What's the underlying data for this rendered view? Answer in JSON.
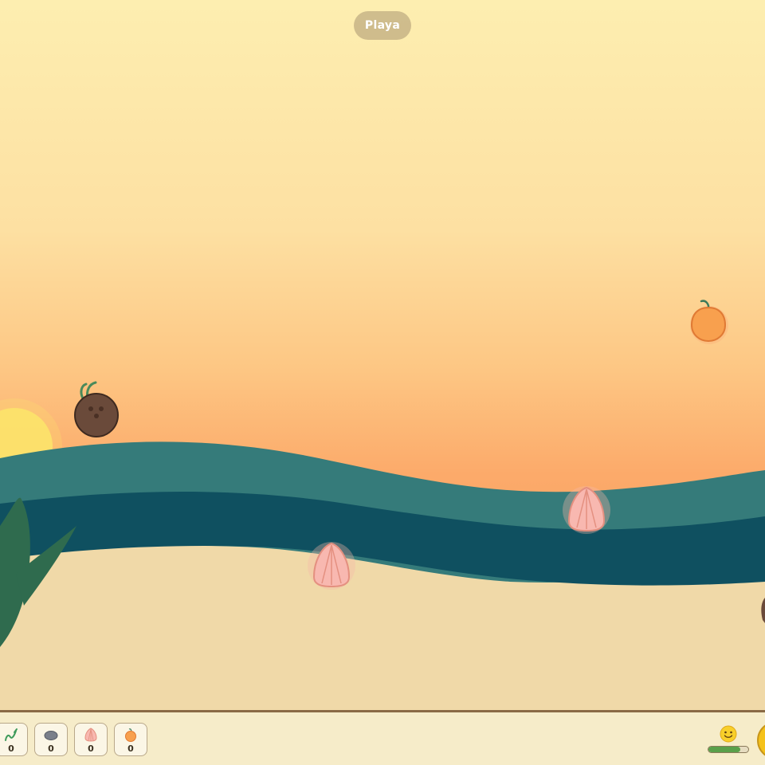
{
  "scene": {
    "location_label": "Playa"
  },
  "world_items": [
    {
      "kind": "coconut",
      "icon": "coconut-icon"
    },
    {
      "kind": "orange-fruit",
      "icon": "orange-fruit-icon"
    },
    {
      "kind": "seashell",
      "icon": "seashell-icon"
    },
    {
      "kind": "seashell",
      "icon": "seashell-icon"
    }
  ],
  "inventory": [
    {
      "icon": "seaweed-icon",
      "count": "0"
    },
    {
      "icon": "stone-icon",
      "count": "0"
    },
    {
      "icon": "seashell-icon",
      "count": "0"
    },
    {
      "icon": "orange-fruit-icon",
      "count": "0"
    }
  ],
  "status": {
    "mood_icon": "smiley-face-icon",
    "mood_level": 0.8
  },
  "colors": {
    "sky_top": "#fdeeb0",
    "sky_bottom": "#fcaa6a",
    "sea_light": "#357b7a",
    "sea_dark": "#0f5060",
    "sand": "#f0d9a8",
    "bar_border": "#8a6a45"
  }
}
